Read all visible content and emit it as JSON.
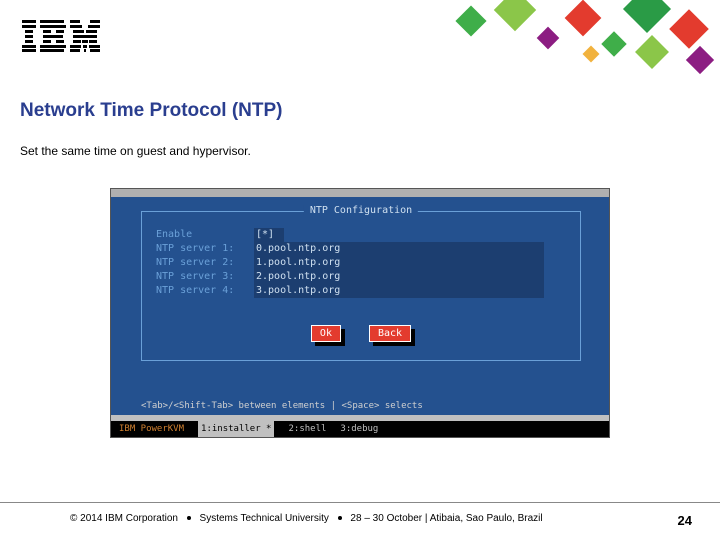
{
  "header": {
    "logo_alt": "IBM"
  },
  "title": "Network Time Protocol (NTP)",
  "subtitle": "Set the same time on guest and hypervisor.",
  "dialog": {
    "title": "NTP Configuration",
    "enable_label": "Enable",
    "enable_value": "[*]",
    "servers": [
      {
        "label": "NTP server 1:",
        "value": "0.pool.ntp.org"
      },
      {
        "label": "NTP server 2:",
        "value": "1.pool.ntp.org"
      },
      {
        "label": "NTP server 3:",
        "value": "2.pool.ntp.org"
      },
      {
        "label": "NTP server 4:",
        "value": "3.pool.ntp.org"
      }
    ],
    "ok": "Ok",
    "back": "Back"
  },
  "hint": "<Tab>/<Shift-Tab> between elements   |   <Space> selects",
  "statusbar": {
    "product": "IBM PowerKVM",
    "tabs": [
      "1:installer *",
      "2:shell",
      "3:debug"
    ]
  },
  "footer": {
    "copyright": "© 2014 IBM Corporation",
    "event": "Systems Technical University",
    "dates": "28 – 30 October | Atibaia, Sao Paulo, Brazil",
    "page": "24"
  }
}
